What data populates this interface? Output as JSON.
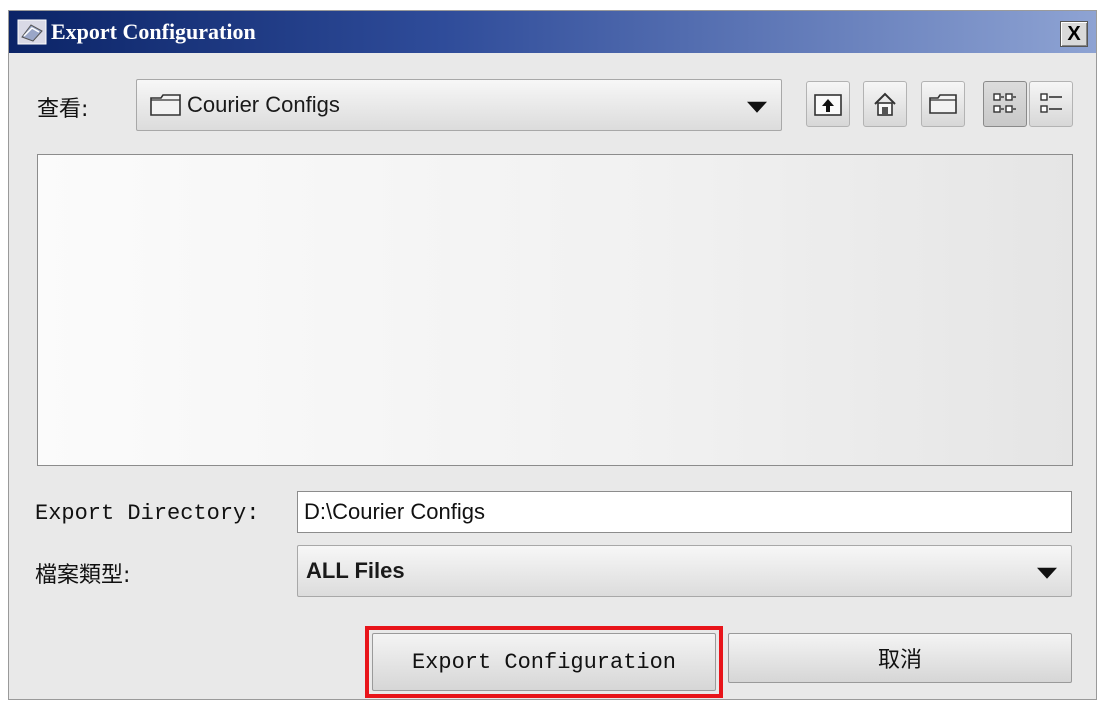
{
  "window": {
    "title": "Export Configuration",
    "close_label": "X"
  },
  "lookin": {
    "label": "查看:",
    "value": "Courier Configs"
  },
  "toolbar": {
    "buttons": [
      {
        "name": "up-one-level-icon"
      },
      {
        "name": "home-icon"
      },
      {
        "name": "new-folder-icon"
      },
      {
        "name": "list-view-icon"
      },
      {
        "name": "details-view-icon"
      }
    ]
  },
  "export_directory": {
    "label": "Export Directory:",
    "value": "D:\\Courier Configs"
  },
  "file_type": {
    "label": "檔案類型:",
    "value": "ALL Files"
  },
  "buttons": {
    "export_label": "Export Configuration",
    "cancel_label": "取消"
  },
  "colors": {
    "title_bar_start": "#0b2467",
    "title_bar_end": "#8ea3d3",
    "highlight": "#e8141a"
  }
}
